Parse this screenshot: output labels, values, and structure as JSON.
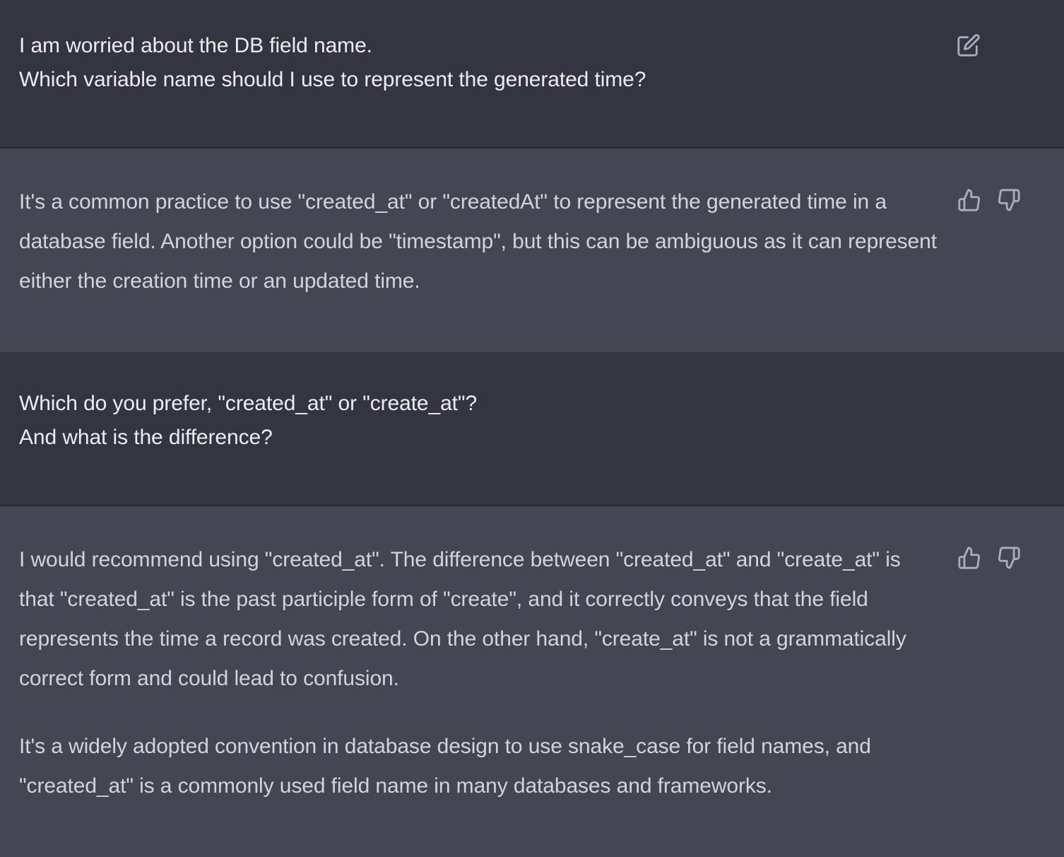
{
  "conversation": {
    "messages": [
      {
        "role": "user",
        "lines": [
          "I am worried about the DB field name.",
          "Which variable name should I use to represent the generated time?"
        ],
        "actions": [
          "edit-icon"
        ]
      },
      {
        "role": "assistant",
        "paragraphs": [
          "It's a common practice to use \"created_at\" or \"createdAt\" to represent the generated time in a database field. Another option could be \"timestamp\", but this can be ambiguous as it can represent either the creation time or an updated time."
        ],
        "actions": [
          "thumbs-up-icon",
          "thumbs-down-icon"
        ]
      },
      {
        "role": "user",
        "lines": [
          "Which do you prefer, \"created_at\" or \"create_at\"?",
          "And what is the difference?"
        ],
        "actions": []
      },
      {
        "role": "assistant",
        "paragraphs": [
          "I would recommend using \"created_at\". The difference between \"created_at\" and \"create_at\" is that \"created_at\" is the past participle form of \"create\", and it correctly conveys that the field represents the time a record was created. On the other hand, \"create_at\" is not a grammatically correct form and could lead to confusion.",
          "It's a widely adopted convention in database design to use snake_case for field names, and \"created_at\" is a commonly used field name in many databases and frameworks."
        ],
        "actions": [
          "thumbs-up-icon",
          "thumbs-down-icon"
        ]
      }
    ]
  },
  "colors": {
    "user_background": "#343541",
    "assistant_background": "#444654",
    "user_text": "#ececf1",
    "assistant_text": "#d1d5db",
    "icon": "#acacbe"
  }
}
